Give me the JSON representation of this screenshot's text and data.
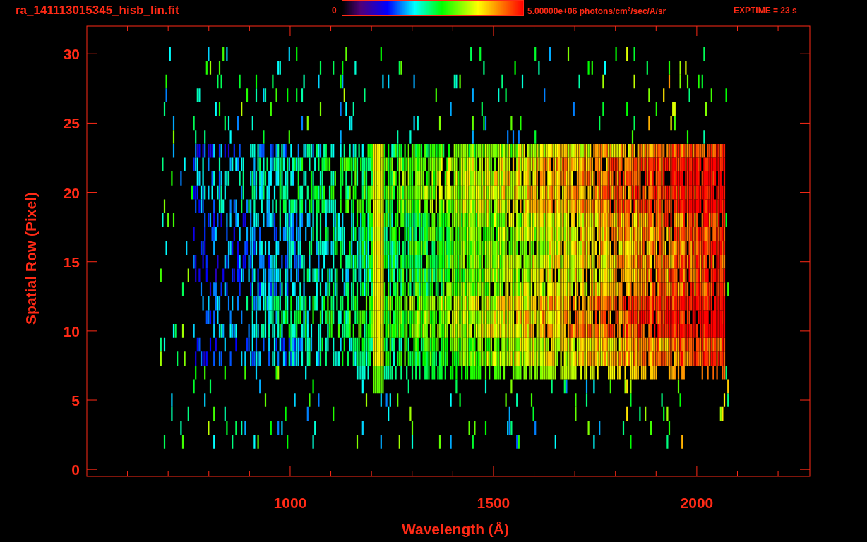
{
  "header": {
    "title": "ra_141113015345_hisb_lin.fit",
    "colorbar_min": "0",
    "colorbar_max": "5.00000e+06 photons/cm$^{2}$/sec/A/sr",
    "exptime": "EXPTIME = 23 s"
  },
  "plot": {
    "xlabel": "Wavelength (Å)",
    "ylabel": "Spatial Row (Pixel)",
    "xticks": [
      "1000",
      "1500",
      "2000"
    ],
    "yticks": [
      "30",
      "25",
      "20",
      "15",
      "10",
      "5",
      "0"
    ]
  }
}
